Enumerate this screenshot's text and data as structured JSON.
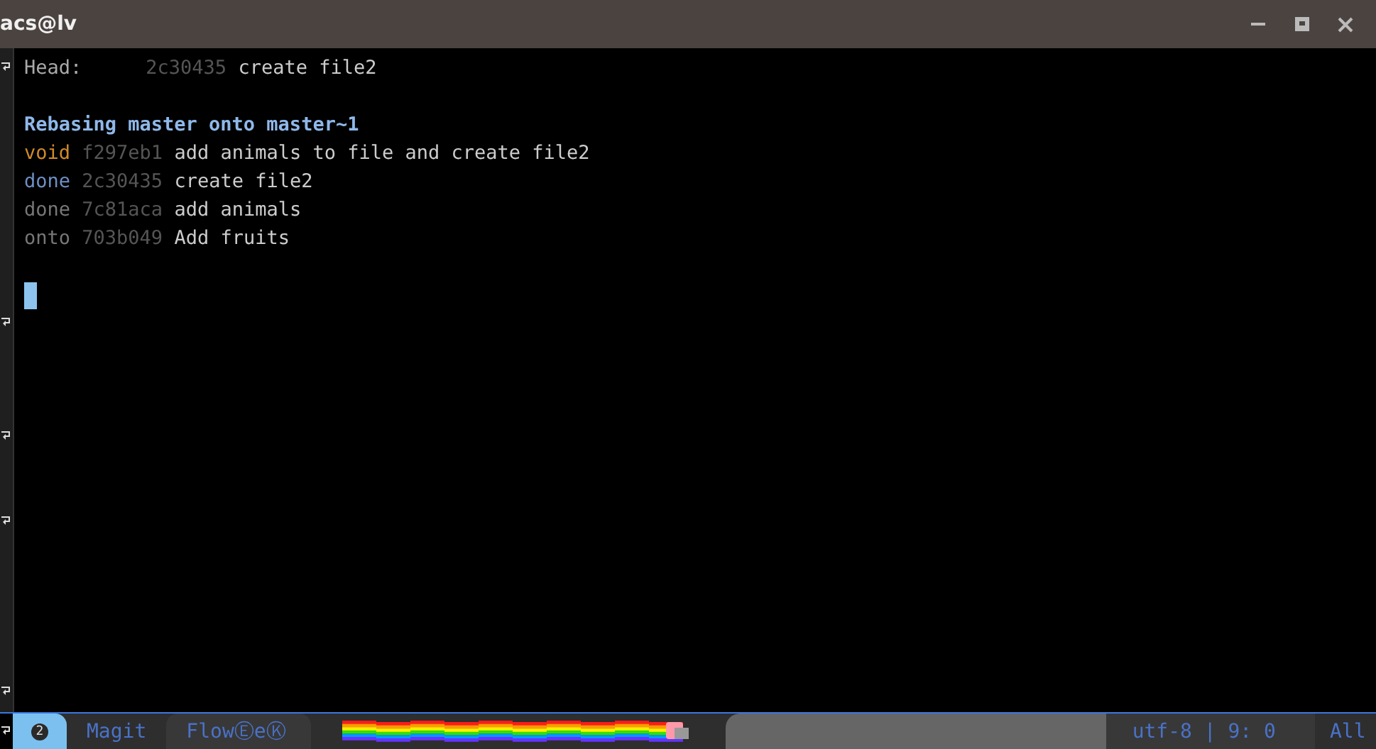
{
  "window": {
    "title": "acs@lv"
  },
  "buffer": {
    "lines": [
      {
        "kind": "head",
        "label": "Head:",
        "hash": "2c30435",
        "message": "create file2"
      },
      {
        "kind": "blank"
      },
      {
        "kind": "heading",
        "text": "Rebasing master onto master~1"
      },
      {
        "kind": "void",
        "action": "void",
        "hash": "f297eb1",
        "message": "add animals to file and create file2"
      },
      {
        "kind": "current",
        "action": "done",
        "hash": "2c30435",
        "message": "create file2"
      },
      {
        "kind": "done",
        "action": "done",
        "hash": "7c81aca",
        "message": "add animals"
      },
      {
        "kind": "onto",
        "action": "onto",
        "hash": "703b049",
        "message": "Add fruits"
      }
    ]
  },
  "mode_line": {
    "window_number": "2",
    "mode": "Magit",
    "minor_mode": "FlowⒺeⓀ",
    "encoding_position": "utf-8 | 9: 0",
    "scroll": "All"
  }
}
